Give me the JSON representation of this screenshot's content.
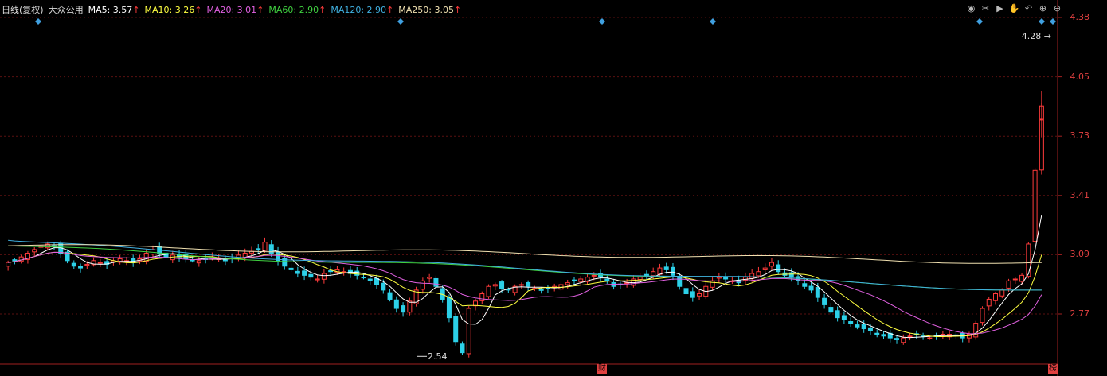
{
  "header": {
    "period": "日线(复权)",
    "name": "大众公用",
    "ma": [
      {
        "label": "MA5: 3.57",
        "color": "#ffffff"
      },
      {
        "label": "MA10: 3.26",
        "color": "#ffff40"
      },
      {
        "label": "MA20: 3.01",
        "color": "#e060e0"
      },
      {
        "label": "MA60: 2.90",
        "color": "#40d040"
      },
      {
        "label": "MA120: 2.90",
        "color": "#40b0e0"
      },
      {
        "label": "MA250: 3.05",
        "color": "#f0e0b0"
      }
    ],
    "arrow": "↑"
  },
  "toolbar": {
    "icons": [
      "eye-icon",
      "scissors-icon",
      "play-icon",
      "hand-icon",
      "undo-icon",
      "zoom-in-icon",
      "zoom-out-icon"
    ],
    "glyphs": [
      "◉",
      "✂",
      "▶",
      "✋",
      "↶",
      "⊕",
      "⊖"
    ]
  },
  "yaxis": {
    "ticks": [
      "4.38",
      "4.05",
      "3.73",
      "3.41",
      "3.09",
      "2.77"
    ]
  },
  "annotations": {
    "last_price": "4.28",
    "low_label": "2.54",
    "event_a": "财",
    "event_b": "榜"
  },
  "chart_data": {
    "type": "candlestick",
    "ylim": [
      2.45,
      4.4
    ],
    "low_value": 2.54,
    "high_marker": 4.28,
    "ma_lines": {
      "MA5": 3.57,
      "MA10": 3.26,
      "MA20": 3.01,
      "MA60": 2.9,
      "MA120": 2.9,
      "MA250": 3.05
    },
    "closes": [
      3.05,
      3.06,
      3.08,
      3.1,
      3.12,
      3.14,
      3.15,
      3.14,
      3.1,
      3.06,
      3.03,
      3.02,
      3.04,
      3.06,
      3.05,
      3.04,
      3.06,
      3.07,
      3.06,
      3.05,
      3.07,
      3.1,
      3.12,
      3.1,
      3.08,
      3.09,
      3.08,
      3.07,
      3.06,
      3.06,
      3.07,
      3.08,
      3.07,
      3.06,
      3.07,
      3.09,
      3.1,
      3.11,
      3.12,
      3.16,
      3.1,
      3.06,
      3.03,
      3.01,
      2.99,
      2.98,
      2.97,
      2.96,
      2.99,
      3.0,
      3.01,
      3.0,
      2.99,
      2.98,
      2.97,
      2.95,
      2.93,
      2.9,
      2.85,
      2.8,
      2.78,
      2.84,
      2.9,
      2.95,
      2.97,
      2.92,
      2.85,
      2.75,
      2.62,
      2.56,
      2.8,
      2.84,
      2.88,
      2.92,
      2.93,
      2.91,
      2.9,
      2.92,
      2.93,
      2.92,
      2.91,
      2.9,
      2.91,
      2.92,
      2.93,
      2.94,
      2.95,
      2.96,
      2.97,
      2.98,
      2.97,
      2.95,
      2.92,
      2.93,
      2.94,
      2.96,
      2.97,
      2.98,
      3.0,
      3.02,
      3.01,
      2.98,
      2.92,
      2.88,
      2.86,
      2.88,
      2.92,
      2.95,
      2.97,
      2.96,
      2.95,
      2.94,
      2.97,
      2.99,
      3.0,
      3.02,
      3.05,
      3.0,
      2.98,
      2.97,
      2.95,
      2.92,
      2.9,
      2.86,
      2.82,
      2.78,
      2.75,
      2.74,
      2.72,
      2.7,
      2.69,
      2.68,
      2.66,
      2.65,
      2.64,
      2.63,
      2.64,
      2.65,
      2.66,
      2.65,
      2.64,
      2.65,
      2.66,
      2.66,
      2.65,
      2.64,
      2.66,
      2.72,
      2.8,
      2.85,
      2.88,
      2.9,
      2.95,
      2.96,
      2.98,
      3.15,
      3.55,
      3.9
    ],
    "ma60_start": 3.14,
    "ma120_start": 3.17,
    "ma250_start": 3.14
  }
}
